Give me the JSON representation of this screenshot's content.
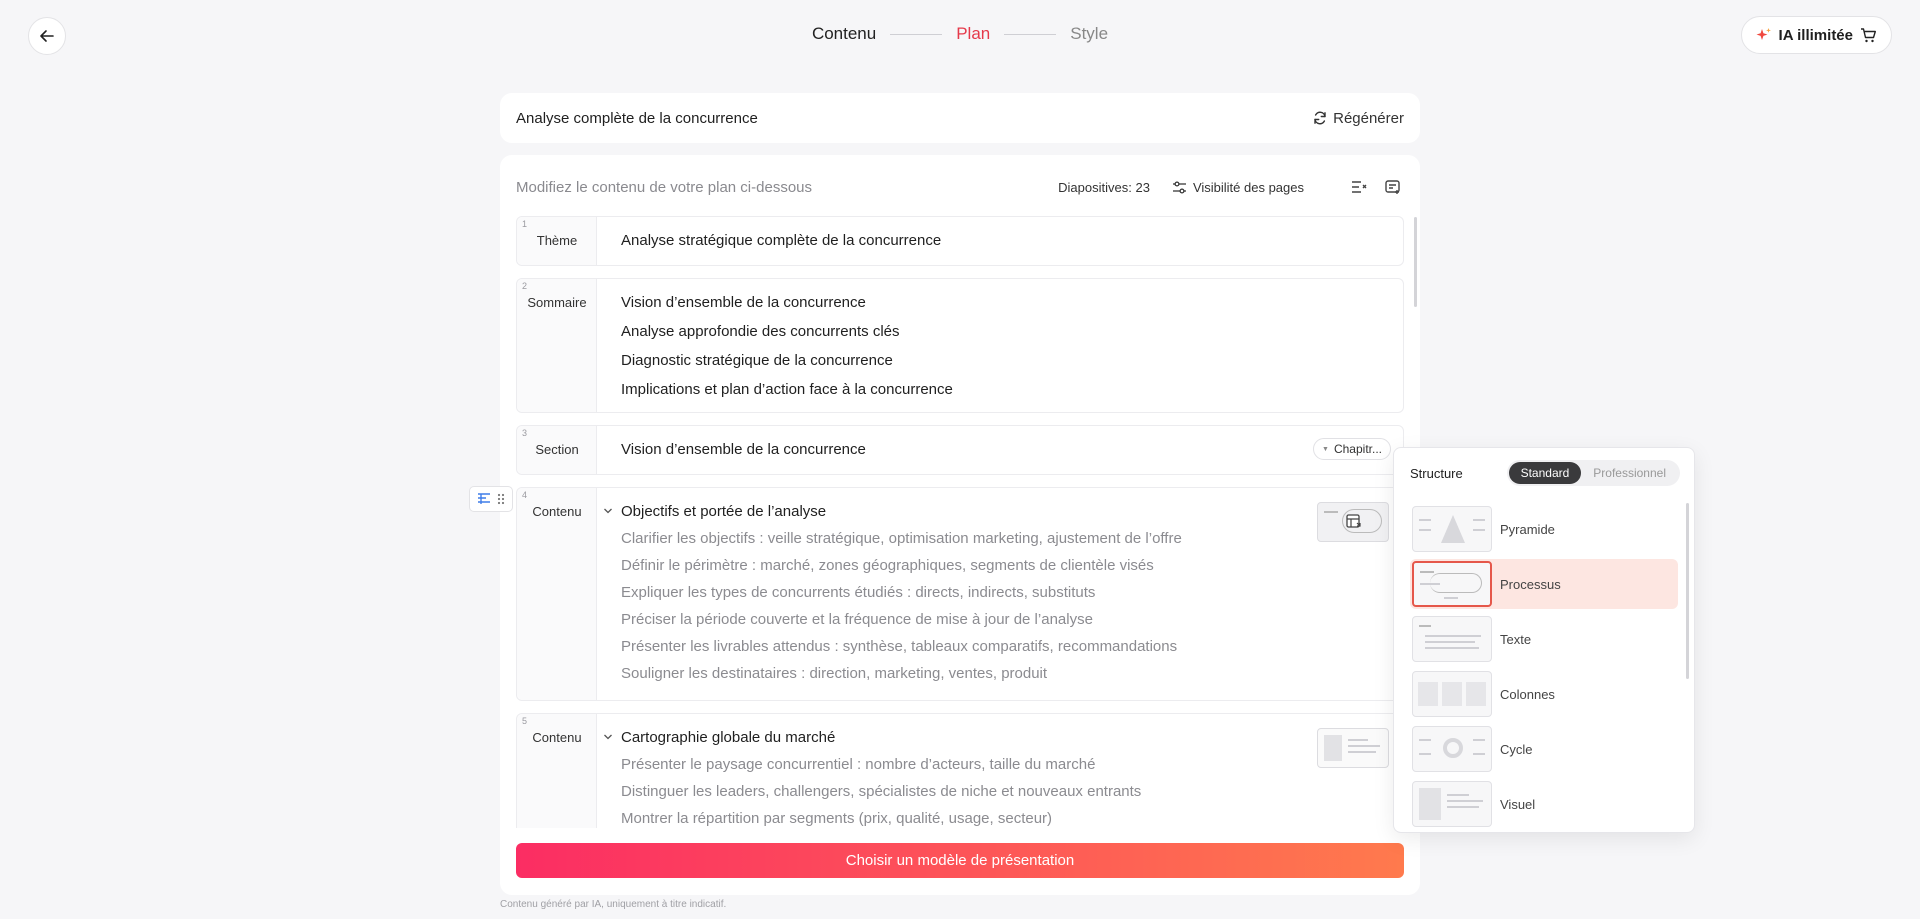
{
  "header": {
    "steps": [
      "Contenu",
      "Plan",
      "Style"
    ],
    "ia_label": "IA illimitée"
  },
  "title_card": {
    "title": "Analyse complète de la concurrence",
    "regenerate": "Régénérer"
  },
  "panel": {
    "hint": "Modifiez le contenu de votre plan ci-dessous",
    "slides_count": "Diapositives: 23",
    "visibility": "Visibilité des pages",
    "cta": "Choisir un modèle de présentation"
  },
  "rows": [
    {
      "num": "1",
      "type": "Thème",
      "lines": [
        "Analyse stratégique complète de la concurrence"
      ]
    },
    {
      "num": "2",
      "type": "Sommaire",
      "lines": [
        "Vision d’ensemble de la concurrence",
        "Analyse approfondie des concurrents clés",
        "Diagnostic stratégique de la concurrence",
        "Implications et plan d’action face à la concurrence"
      ]
    },
    {
      "num": "3",
      "type": "Section",
      "lines": [
        "Vision d’ensemble de la concurrence"
      ],
      "chapter": "Chapitr..."
    },
    {
      "num": "4",
      "type": "Contenu",
      "title": "Objectifs et portée de l’analyse",
      "lines": [
        "Clarifier les objectifs : veille stratégique, optimisation marketing, ajustement de l’offre",
        "Définir le périmètre : marché, zones géographiques, segments de clientèle visés",
        "Expliquer les types de concurrents étudiés : directs, indirects, substituts",
        "Préciser la période couverte et la fréquence de mise à jour de l’analyse",
        "Présenter les livrables attendus : synthèse, tableaux comparatifs, recommandations",
        "Souligner les destinataires : direction, marketing, ventes, produit"
      ]
    },
    {
      "num": "5",
      "type": "Contenu",
      "title": "Cartographie globale du marché",
      "lines": [
        "Présenter le paysage concurrentiel : nombre d’acteurs, taille du marché",
        "Distinguer les leaders, challengers, spécialistes de niche et nouveaux entrants",
        "Montrer la répartition par segments (prix, qualité, usage, secteur)"
      ]
    }
  ],
  "structure_popover": {
    "title": "Structure",
    "tabs": [
      "Standard",
      "Professionnel"
    ],
    "options": [
      "Pyramide",
      "Processus",
      "Texte",
      "Colonnes",
      "Cycle",
      "Visuel"
    ],
    "selected": "Processus"
  },
  "footnote": "Contenu généré par IA, uniquement à titre indicatif.",
  "colors": {
    "accent": "#e5394a",
    "cta_start": "#fb2d63",
    "cta_end": "#ff7a4d",
    "selected_bg": "#fde6e1"
  }
}
